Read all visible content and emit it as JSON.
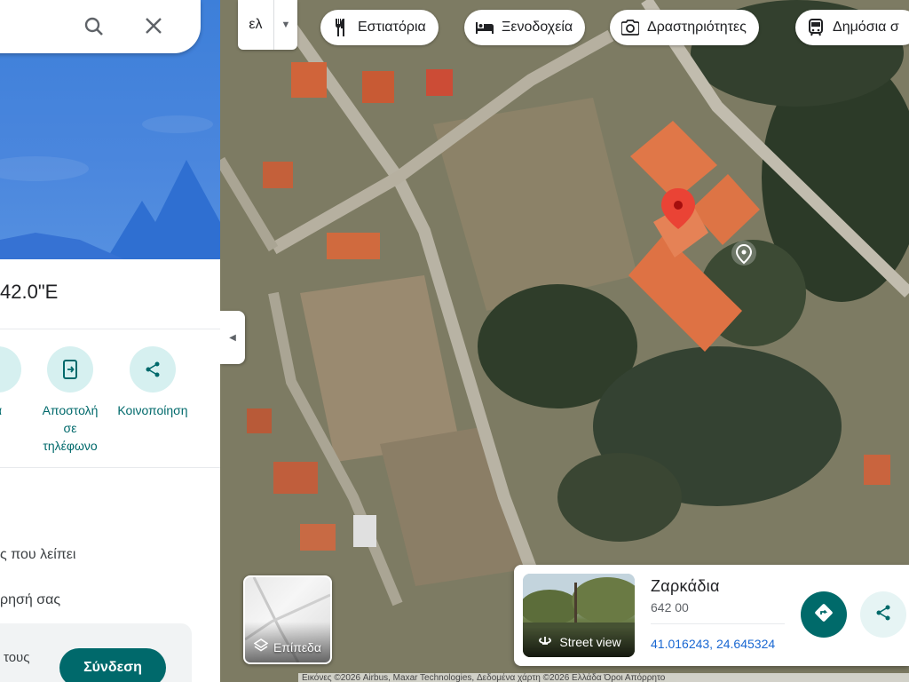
{
  "search": {
    "search_icon": "search-icon",
    "close_icon": "close-icon"
  },
  "panel": {
    "coordinates_partial": "42.0\"E",
    "actions": [
      {
        "label": "ά",
        "icon": "save-icon"
      },
      {
        "label": "Αποστολή σε τηλέφωνο",
        "icon": "send-to-phone-icon"
      },
      {
        "label": "Κοινοποίηση",
        "icon": "share-icon"
      }
    ],
    "missing_place_text": "ς που λείπει",
    "contribution_text": "ρησή σας",
    "signin_hint": "τους",
    "signin_label": "Σύνδεση"
  },
  "map": {
    "language": "ελ",
    "chips": [
      {
        "label": "Εστιατόρια",
        "icon": "restaurant-icon"
      },
      {
        "label": "Ξενοδοχεία",
        "icon": "hotel-icon"
      },
      {
        "label": "Δραστηριότητες",
        "icon": "camera-icon"
      },
      {
        "label": "Δημόσια σ",
        "icon": "transit-icon"
      }
    ],
    "layers_label": "Επίπεδα",
    "footer": "Εικόνες ©2026 Airbus, Maxar Technologies, Δεδομένα χάρτη ©2026    Ελλάδα    Όροι    Απόρρητο"
  },
  "place_card": {
    "name": "Ζαρκάδια",
    "postal_code": "642 00",
    "coordinates": "41.016243, 24.645324",
    "street_view_label": "Street view"
  },
  "colors": {
    "accent_teal": "#00696b",
    "pin_red": "#ea4335",
    "hero_blue": "#4a86dd"
  }
}
